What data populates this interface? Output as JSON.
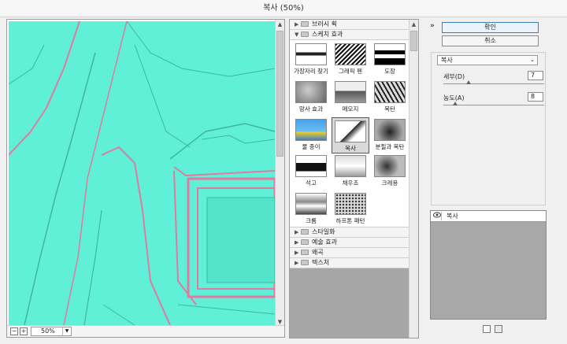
{
  "window": {
    "title": "복사 (50%)"
  },
  "preview": {
    "zoom": "50%",
    "zoom_minus": "−",
    "zoom_plus": "+"
  },
  "gallery": {
    "categories_top": [
      {
        "label": "브러시 획",
        "expanded": false
      },
      {
        "label": "스케치 효과",
        "expanded": true
      }
    ],
    "thumbnails": [
      {
        "label": "가장자리 찾기"
      },
      {
        "label": "그래픽 펜"
      },
      {
        "label": "도장"
      },
      {
        "label": "망사 효과"
      },
      {
        "label": "메모지"
      },
      {
        "label": "목탄"
      },
      {
        "label": "물 종이"
      },
      {
        "label": "복사"
      },
      {
        "label": "분필과 목탄"
      },
      {
        "label": "석고"
      },
      {
        "label": "채우조"
      },
      {
        "label": "크레용"
      },
      {
        "label": "크롬"
      },
      {
        "label": "하프톤 패턴"
      }
    ],
    "selected_index": 7,
    "categories_bottom": [
      {
        "label": "스타일화"
      },
      {
        "label": "예술 효과"
      },
      {
        "label": "왜곡"
      },
      {
        "label": "텍스처"
      }
    ]
  },
  "settings": {
    "ok_label": "확인",
    "cancel_label": "취소",
    "filter": "복사",
    "params": [
      {
        "label": "세부(D)",
        "value": "7",
        "fraction": 0.25
      },
      {
        "label": "농도(A)",
        "value": "8",
        "fraction": 0.12
      }
    ],
    "collapse_icon": "»"
  },
  "layers": {
    "items": [
      {
        "name": "복사"
      }
    ]
  },
  "icons": {
    "eye": "eye-icon",
    "new": "new-layer-icon",
    "delete": "trash-icon"
  }
}
